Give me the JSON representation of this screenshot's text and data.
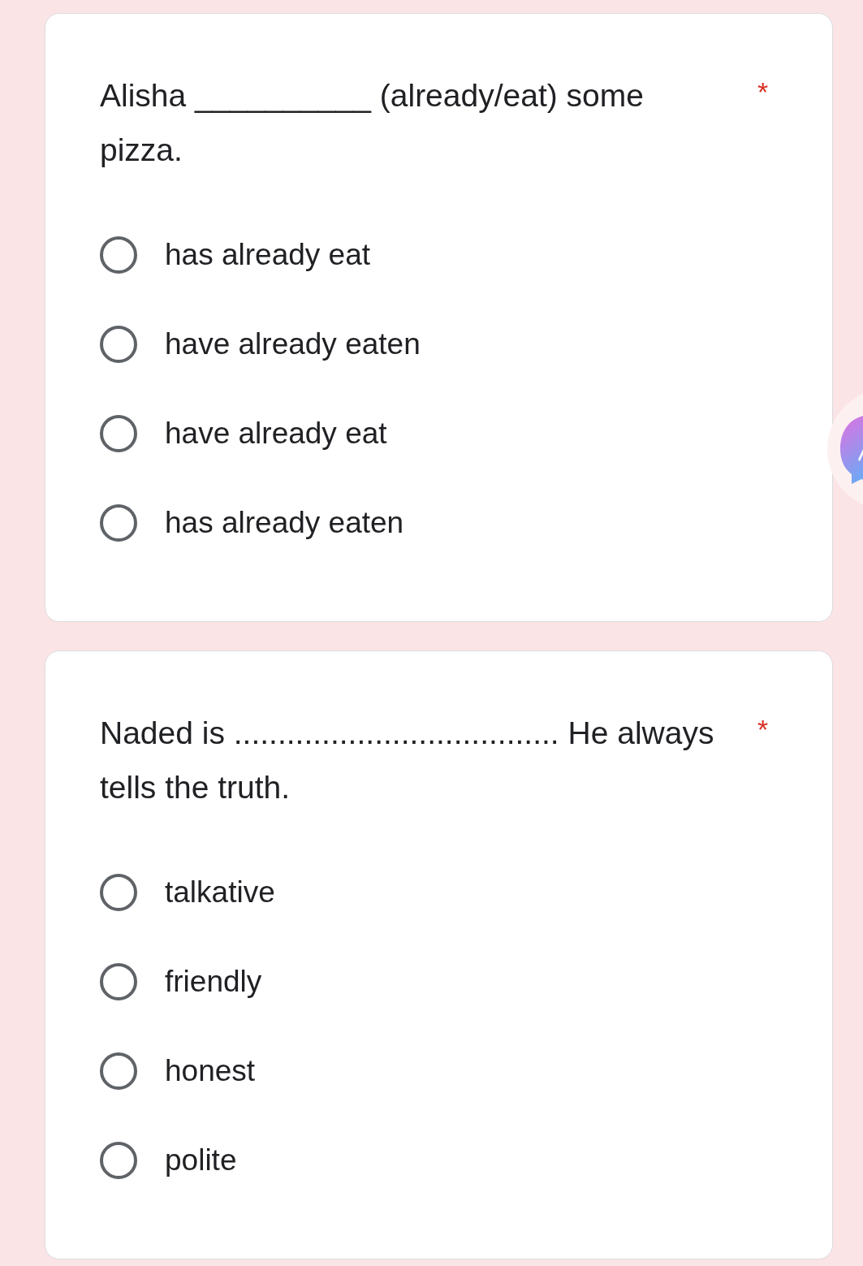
{
  "questions": [
    {
      "text": "Alisha __________ (already/eat) some pizza.",
      "required_mark": "*",
      "options": [
        {
          "label": "has already eat",
          "selected": false
        },
        {
          "label": "have already eaten",
          "selected": false
        },
        {
          "label": "have already eat",
          "selected": false
        },
        {
          "label": "has already eaten",
          "selected": false
        }
      ]
    },
    {
      "text": "Naded is ..................................... He always tells the truth.",
      "required_mark": "*",
      "options": [
        {
          "label": "talkative",
          "selected": false
        },
        {
          "label": "friendly",
          "selected": false
        },
        {
          "label": "honest",
          "selected": false
        },
        {
          "label": "polite",
          "selected": false
        }
      ]
    }
  ]
}
